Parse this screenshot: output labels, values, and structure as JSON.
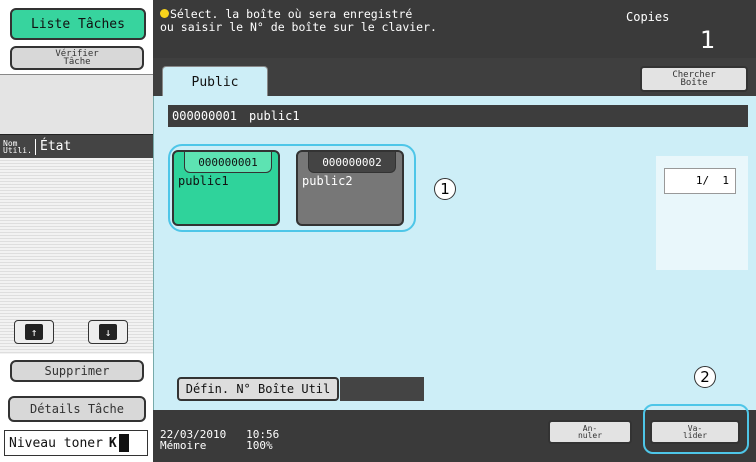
{
  "left": {
    "job_list_label": "Liste Tâches",
    "check_job_label": "Vérifier\nTâche",
    "col_user": "Nom\nUtili.",
    "col_status": "État",
    "delete_label": "Supprimer",
    "job_details_label": "Détails Tâche",
    "toner_label": "Niveau toner",
    "toner_color": "K"
  },
  "header": {
    "message": "Sélect. la boîte où sera enregistré\nou saisir le N° de boîte sur le clavier.",
    "copies_label": "Copies",
    "copies_count": "1"
  },
  "tabs": {
    "public_label": "Public",
    "search_box_label": "Chercher\nBoîte"
  },
  "selected_box": {
    "number": "000000001",
    "name": "public1"
  },
  "boxes": [
    {
      "number": "000000001",
      "name": "public1"
    },
    {
      "number": "000000002",
      "name": "public2"
    }
  ],
  "callouts": [
    "1",
    "2"
  ],
  "pager": {
    "text": "1/  1"
  },
  "box_number_button_label": "Défin. N° Boîte Util",
  "footer": {
    "datetime": "22/03/2010   10:56",
    "memory": "Mémoire      100%",
    "cancel_label": "An-\nnuler",
    "ok_label": "Va-\nlider"
  },
  "colors": {
    "accent_green": "#2fd39b",
    "highlight_cyan": "#4ec6e8",
    "panel_blue": "#cdeef7"
  }
}
